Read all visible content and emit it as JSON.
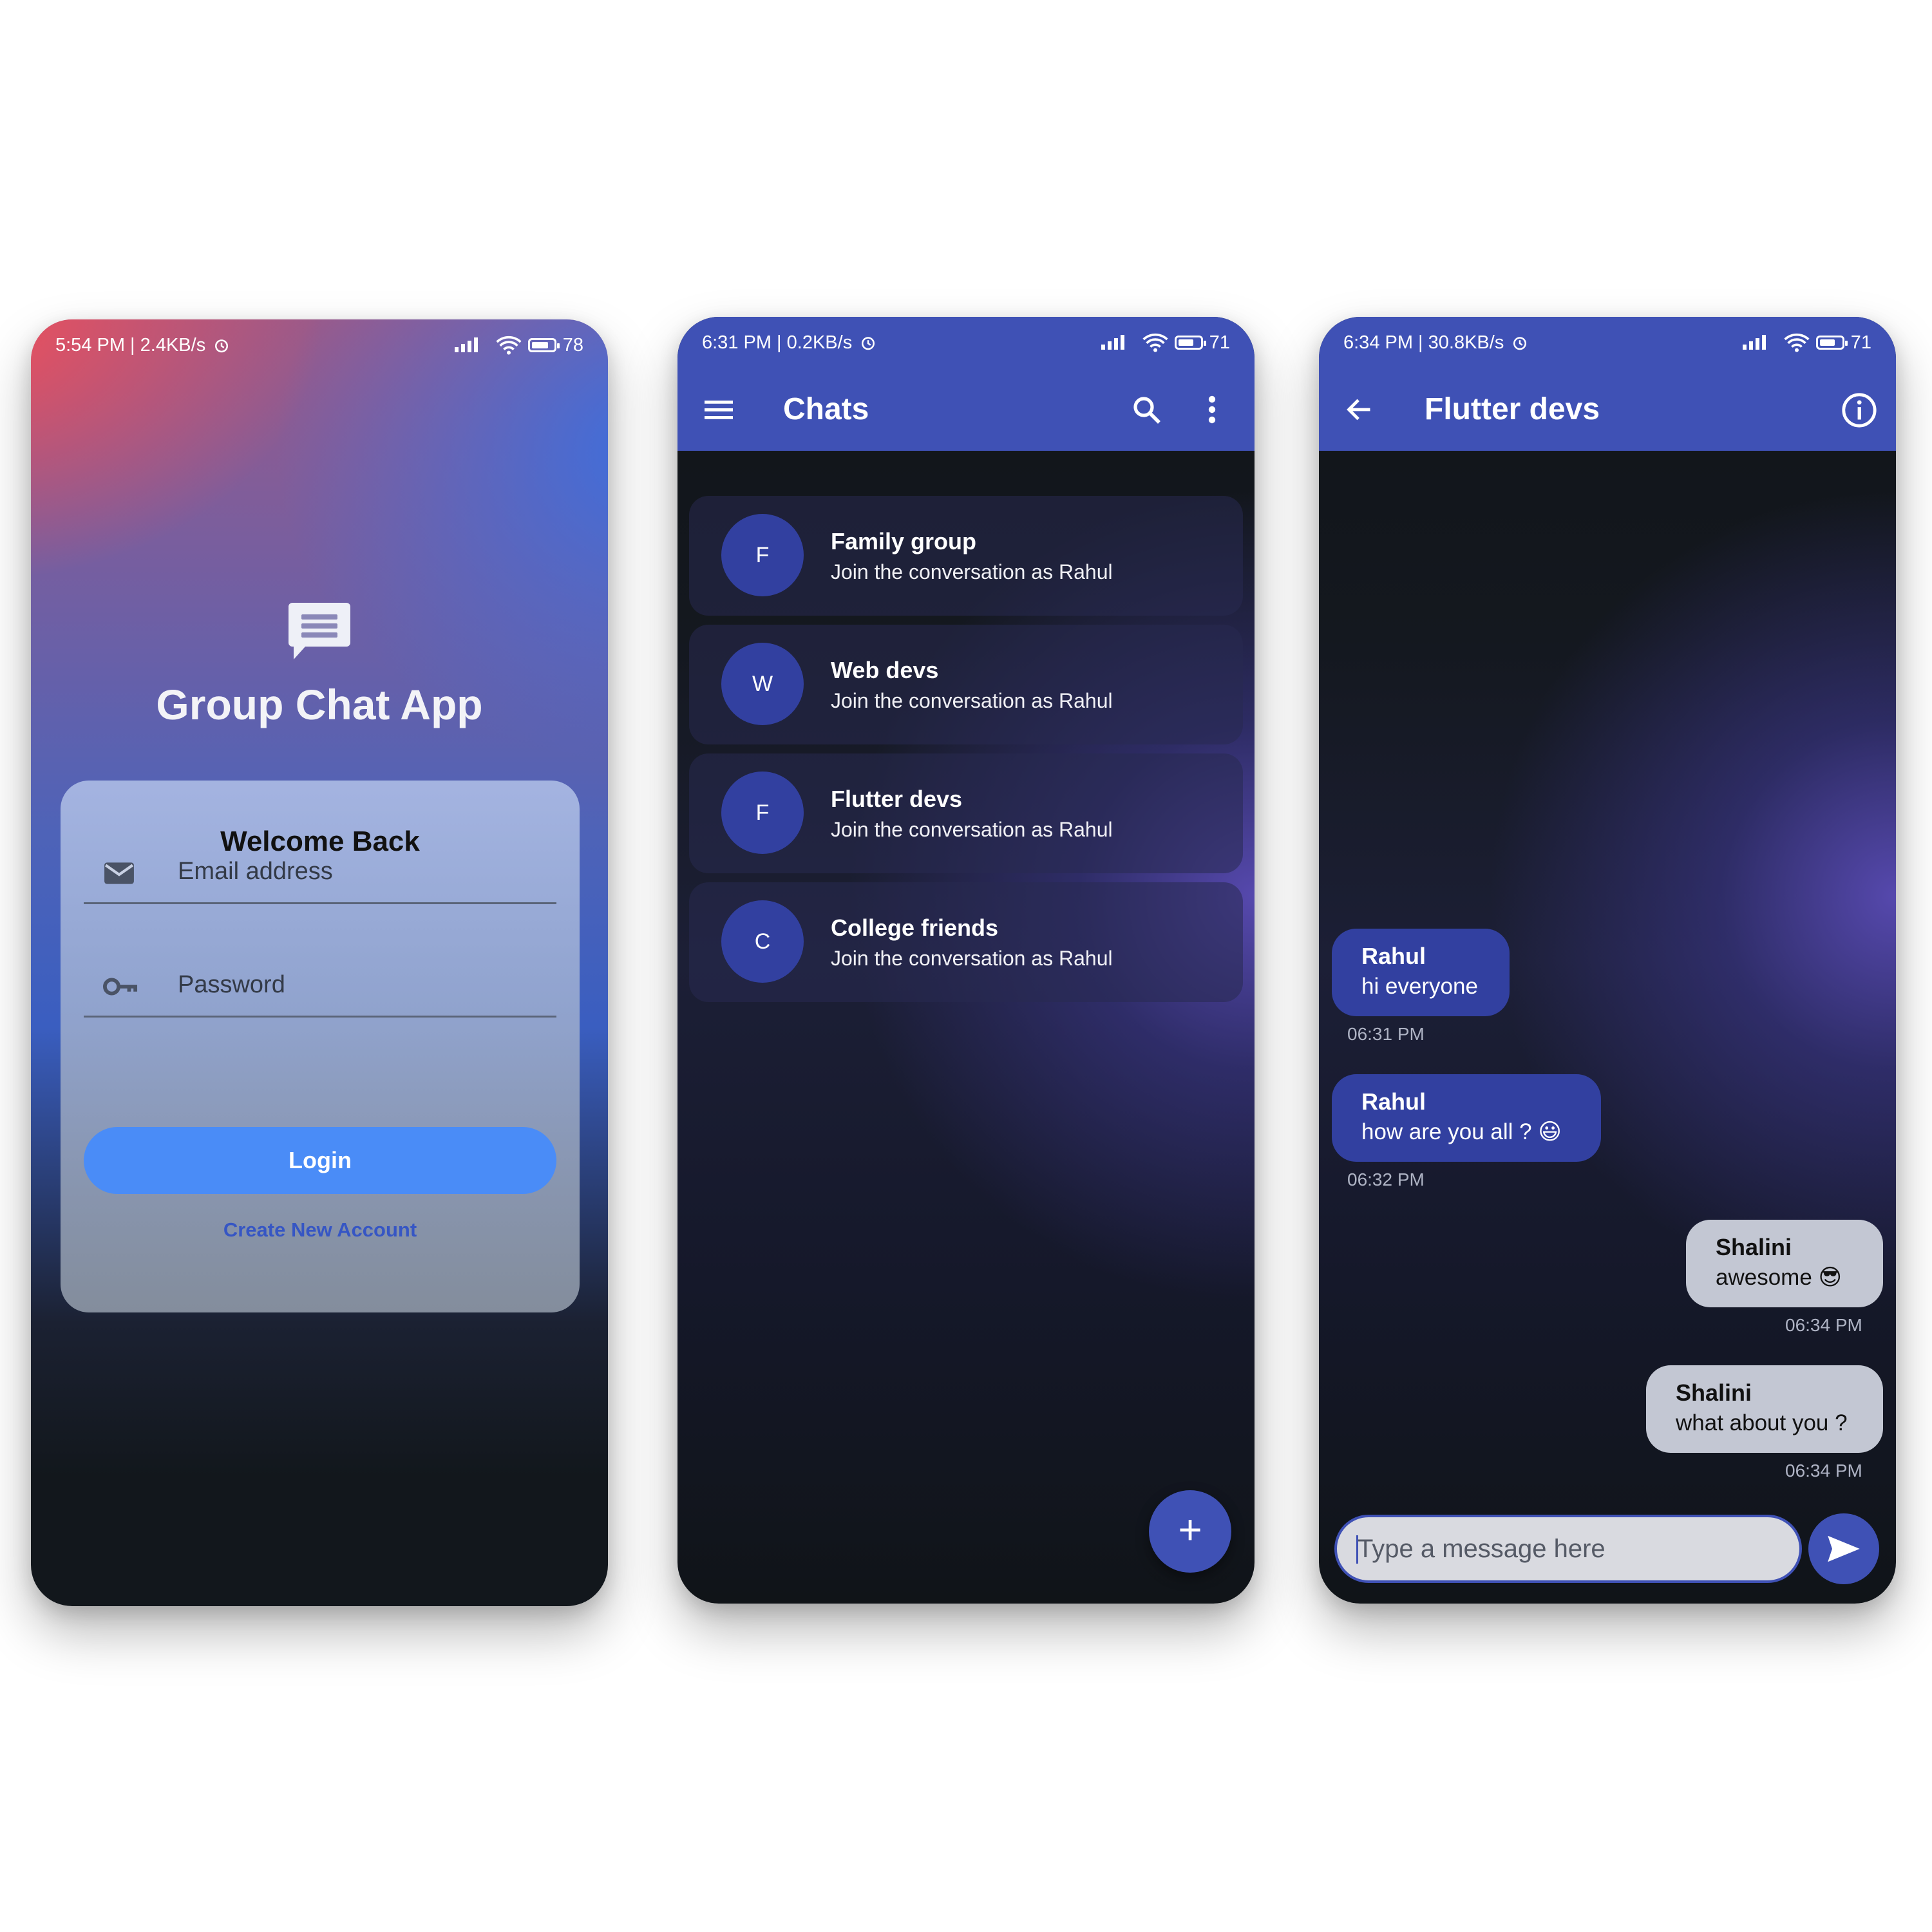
{
  "colors": {
    "primary": "#3f51b5",
    "login_button": "#4a8cf7",
    "link": "#3656c4",
    "dark_bg": "#12171c"
  },
  "login": {
    "status": {
      "time": "5:54 PM | 2.4KB/s",
      "battery": "78",
      "battery_level": 0.78
    },
    "app_icon": "chat-bubble-icon",
    "app_title": "Group Chat App",
    "card_title": "Welcome Back",
    "email_placeholder": "Email address",
    "password_placeholder": "Password",
    "login_label": "Login",
    "create_account_label": "Create New Account"
  },
  "chats": {
    "status": {
      "time": "6:31 PM | 0.2KB/s",
      "battery": "71",
      "battery_level": 0.71
    },
    "title": "Chats",
    "items": [
      {
        "initial": "F",
        "name": "Family group",
        "subtitle": "Join the conversation as Rahul"
      },
      {
        "initial": "W",
        "name": "Web devs",
        "subtitle": "Join the conversation as Rahul"
      },
      {
        "initial": "F",
        "name": "Flutter devs",
        "subtitle": "Join the conversation as Rahul"
      },
      {
        "initial": "C",
        "name": "College friends",
        "subtitle": "Join the conversation as Rahul"
      }
    ],
    "fab_label": "+"
  },
  "conversation": {
    "status": {
      "time": "6:34 PM | 30.8KB/s",
      "battery": "71",
      "battery_level": 0.71
    },
    "title": "Flutter devs",
    "messages": [
      {
        "sender": "Rahul",
        "text": "hi everyone",
        "time": "06:31 PM"
      },
      {
        "sender": "Rahul",
        "text": "how are you all ? 😃",
        "time": "06:32 PM"
      },
      {
        "sender": "Shalini",
        "text": "awesome 😎",
        "time": "06:34 PM"
      },
      {
        "sender": "Shalini",
        "text": "what about you ?",
        "time": "06:34 PM"
      }
    ],
    "input_placeholder": "Type a message here"
  }
}
